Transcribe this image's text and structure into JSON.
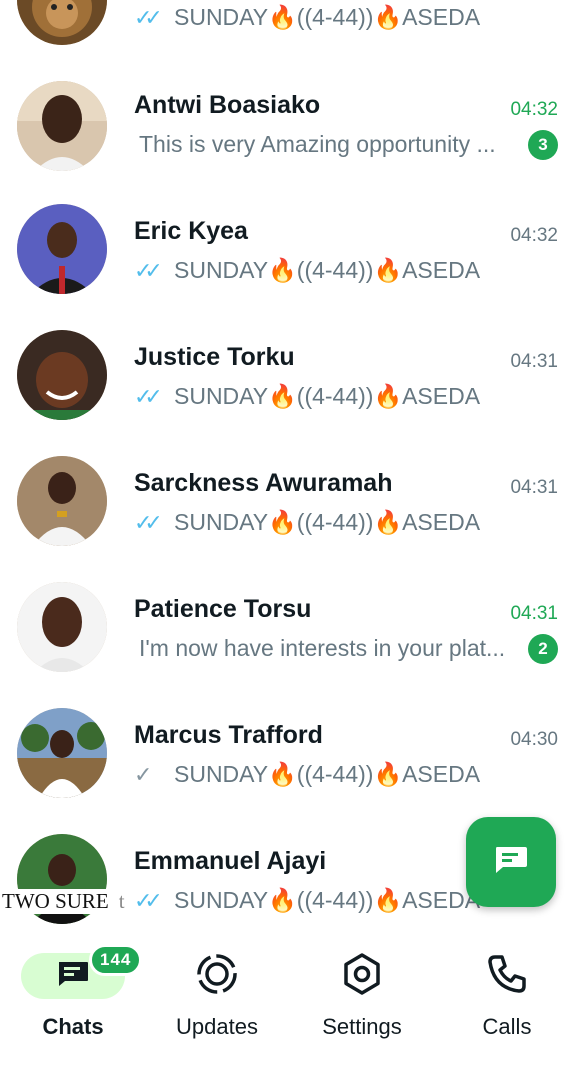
{
  "chats": [
    {
      "name": "",
      "time": "",
      "preview_text": "SUNDAY🔥((4-44))🔥ASEDA",
      "ticks": "double",
      "unread": null,
      "avatar": "lion-avatar"
    },
    {
      "name": "Antwi Boasiako",
      "time": "04:32",
      "preview_text": "This is very Amazing opportunity ...",
      "ticks": "none",
      "unread": "3",
      "avatar": "man-avatar"
    },
    {
      "name": "Eric Kyea",
      "time": "04:32",
      "preview_text": "SUNDAY🔥((4-44))🔥ASEDA",
      "ticks": "double",
      "unread": null,
      "avatar": "man-red-tie-avatar"
    },
    {
      "name": "Justice Torku",
      "time": "04:31",
      "preview_text": "SUNDAY🔥((4-44))🔥ASEDA",
      "ticks": "double",
      "unread": null,
      "avatar": "woman-braids-avatar"
    },
    {
      "name": "Sarckness Awuramah",
      "time": "04:31",
      "preview_text": "SUNDAY🔥((4-44))🔥ASEDA",
      "ticks": "double",
      "unread": null,
      "avatar": "man-white-outfit-avatar"
    },
    {
      "name": "Patience Torsu",
      "time": "04:31",
      "preview_text": "I'm now have interests in your plat...",
      "ticks": "none",
      "unread": "2",
      "avatar": "woman-avatar"
    },
    {
      "name": "Marcus Trafford",
      "time": "04:30",
      "preview_text": "SUNDAY🔥((4-44))🔥ASEDA",
      "ticks": "single",
      "unread": null,
      "avatar": "woman-outdoor-avatar"
    },
    {
      "name": "Emmanuel Ajayi",
      "time": "",
      "preview_text": "SUNDAY🔥((4-44))🔥ASEDA",
      "ticks": "double",
      "unread": null,
      "avatar": "man-suit-avatar"
    }
  ],
  "overlay": {
    "text": "TWO SURE",
    "trailing": "t"
  },
  "fab": {
    "icon": "new-chat-icon"
  },
  "nav": {
    "items": [
      {
        "label": "Chats",
        "icon": "chats-icon",
        "badge": "144",
        "active": true
      },
      {
        "label": "Updates",
        "icon": "updates-icon",
        "active": false
      },
      {
        "label": "Settings",
        "icon": "settings-icon",
        "active": false
      },
      {
        "label": "Calls",
        "icon": "calls-icon",
        "active": false
      }
    ]
  },
  "colors": {
    "accent": "#1fa855",
    "tick_blue": "#53bdeb",
    "muted": "#667781",
    "pill": "#d8fdd2"
  }
}
